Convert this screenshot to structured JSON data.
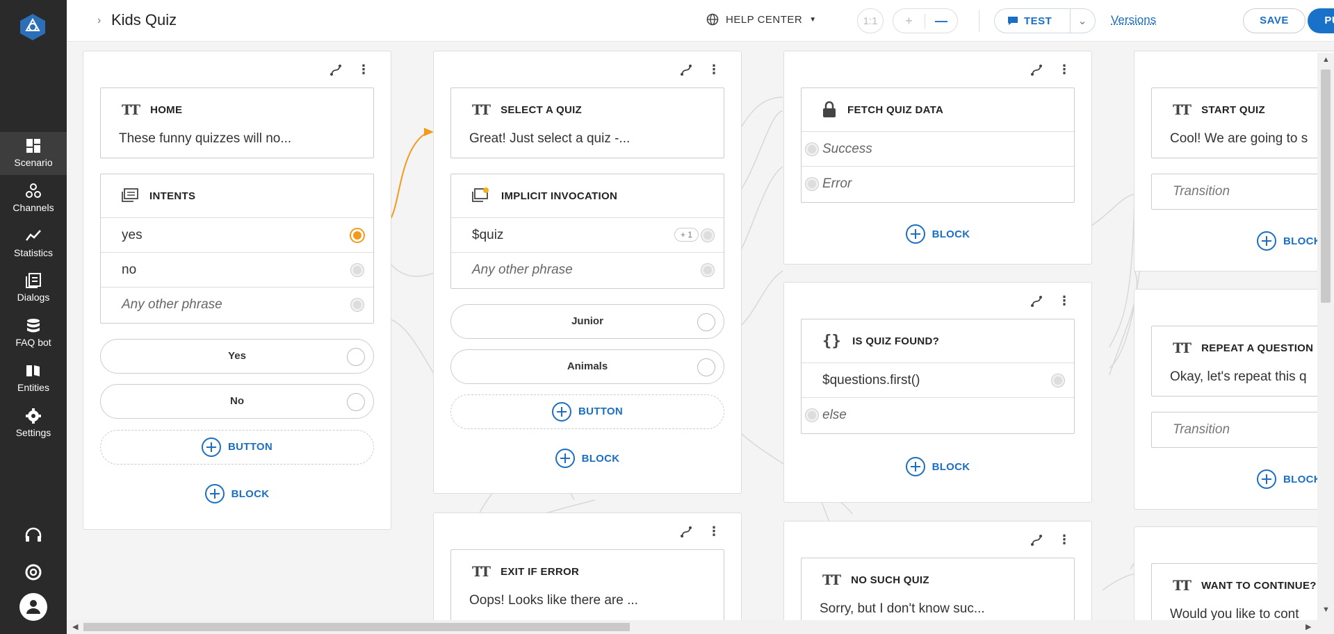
{
  "colors": {
    "accent": "#1a72c8",
    "sidebar_bg": "#2a2a2a",
    "active_dot": "#f29a1a"
  },
  "sidebar": {
    "items": [
      {
        "label": "Scenario",
        "icon": "grid-icon"
      },
      {
        "label": "Channels",
        "icon": "channels-icon"
      },
      {
        "label": "Statistics",
        "icon": "chart-line-icon"
      },
      {
        "label": "Dialogs",
        "icon": "dialogs-icon"
      },
      {
        "label": "FAQ bot",
        "icon": "database-icon"
      },
      {
        "label": "Entities",
        "icon": "book-icon"
      },
      {
        "label": "Settings",
        "icon": "gear-icon"
      }
    ]
  },
  "header": {
    "title": "Kids Quiz",
    "help_center": "HELP CENTER",
    "zoom_reset": "1:1",
    "test": "TEST",
    "versions": "Versions",
    "save": "SAVE",
    "publish": "PUBLISH"
  },
  "cards": {
    "home": {
      "title": "HOME",
      "text": "These funny quizzes will no...",
      "intents_title": "INTENTS",
      "intents": [
        "yes",
        "no",
        "Any other phrase"
      ],
      "buttons": [
        "Yes",
        "No"
      ],
      "add_button": "BUTTON",
      "add_block": "BLOCK"
    },
    "select": {
      "title": "SELECT A QUIZ",
      "text": "Great! Just select a quiz -...",
      "implicit_title": "IMPLICIT INVOCATION",
      "quiz_var": "$quiz",
      "quiz_badge": "+ 1",
      "any_phrase": "Any other phrase",
      "buttons": [
        "Junior",
        "Animals"
      ],
      "add_button": "BUTTON",
      "add_block": "BLOCK"
    },
    "fetch": {
      "title": "FETCH QUIZ DATA",
      "rows": [
        "Success",
        "Error"
      ],
      "add_block": "BLOCK"
    },
    "found": {
      "title": "IS QUIZ FOUND?",
      "condition": "$questions.first()",
      "else": "else",
      "add_block": "BLOCK"
    },
    "start": {
      "title": "START QUIZ",
      "text": "Cool! We are going to s",
      "transition": "Transition",
      "add_block": "BLOCK"
    },
    "repeat": {
      "title": "REPEAT A QUESTION",
      "text": "Okay, let's repeat this q",
      "transition": "Transition",
      "add_block": "BLOCK"
    },
    "exit": {
      "title": "EXIT IF ERROR",
      "text": "Oops! Looks like there are ..."
    },
    "nosuch": {
      "title": "NO SUCH QUIZ",
      "text": "Sorry, but I don't know suc..."
    },
    "continue": {
      "title": "WANT TO CONTINUE?",
      "text": "Would you like to cont"
    }
  }
}
